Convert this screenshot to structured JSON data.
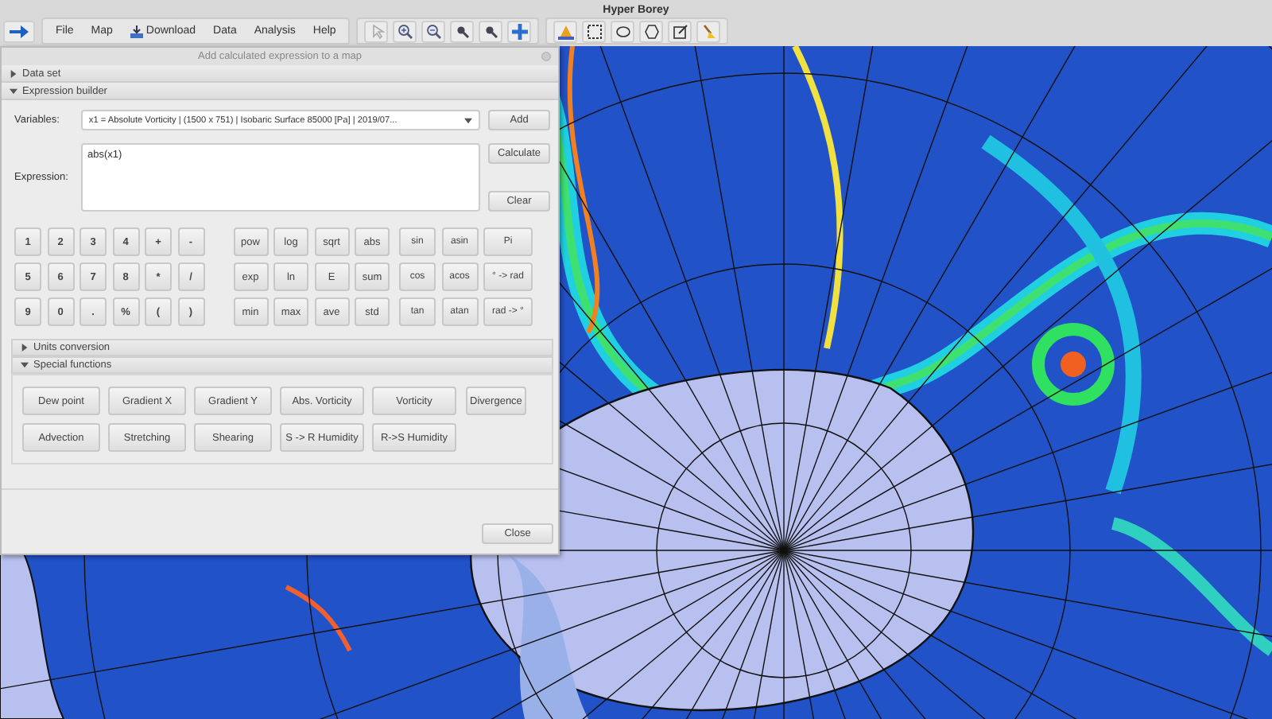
{
  "app": {
    "title": "Hyper Borey"
  },
  "menu": [
    {
      "label": "File",
      "kind": "plain"
    },
    {
      "label": "Map",
      "kind": "plain"
    },
    {
      "label": "Download",
      "kind": "icon"
    },
    {
      "label": "Data",
      "kind": "plain"
    },
    {
      "label": "Analysis",
      "kind": "plain"
    },
    {
      "label": "Help",
      "kind": "plain"
    }
  ],
  "dialog": {
    "title": "Add calculated expression to a map",
    "sections": [
      {
        "title": "Data set",
        "expanded": false
      },
      {
        "title": "Expression builder",
        "expanded": true
      }
    ],
    "variables": {
      "label": "Variables:",
      "value": "x1 = Absolute Vorticity | (1500 x 751) | Isobaric Surface 85000 [Pa] | 2019/07...",
      "button": "Add"
    },
    "expression": {
      "label": "Expression:",
      "value": "abs(x1)",
      "buttons": [
        "Calculate",
        "Clear"
      ]
    },
    "keypad": [
      {
        "kind": "narrow",
        "keys": [
          "1",
          "2",
          "3",
          "4",
          "+",
          "-",
          "5",
          "6",
          "7",
          "8",
          "*",
          "/",
          "9",
          "0",
          ".",
          "%",
          "(",
          ")"
        ]
      },
      {
        "kind": "medium",
        "keys": [
          "pow",
          "log",
          "sqrt",
          "abs",
          "exp",
          "ln",
          "E",
          "sum",
          "min",
          "max",
          "ave",
          "std"
        ]
      },
      {
        "kind": "trig",
        "keys": [
          "sin",
          "asin",
          "Pi",
          "cos",
          "acos",
          "° -> rad",
          "tan",
          "atan",
          "rad -> °"
        ]
      }
    ],
    "subsections": [
      {
        "title": "Units conversion",
        "expanded": false
      },
      {
        "title": "Special functions",
        "expanded": true
      }
    ],
    "functions": [
      "Dew point",
      "Gradient X",
      "Gradient Y",
      "Abs. Vorticity",
      "Vorticity",
      "Divergence",
      "Advection",
      "Stretching",
      "Shearing",
      "S -> R Humidity",
      "R->S Humidity"
    ],
    "close": "Close"
  }
}
